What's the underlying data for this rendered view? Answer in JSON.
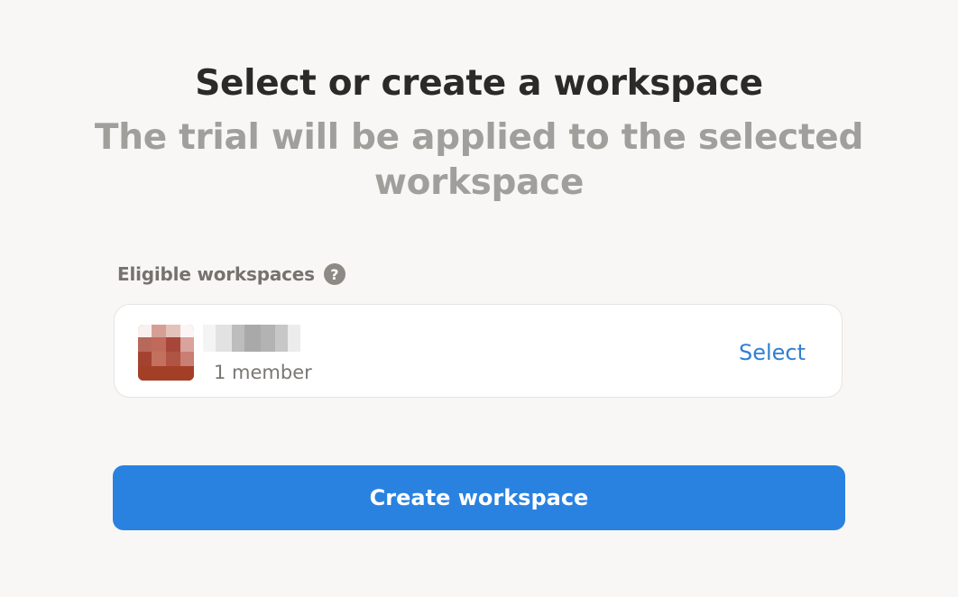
{
  "header": {
    "title": "Select or create a workspace",
    "subtitle": "The trial will be applied to the selected workspace"
  },
  "eligible": {
    "label": "Eligible workspaces",
    "help_icon": "question-circle-icon",
    "help_glyph": "?"
  },
  "workspaces": [
    {
      "icon": "workspace-avatar-icon",
      "name_redacted": true,
      "members": "1 member",
      "select_label": "Select"
    }
  ],
  "actions": {
    "create_label": "Create workspace"
  },
  "colors": {
    "background": "#f8f7f5",
    "accent": "#2a82e0",
    "link": "#2f7fd4",
    "avatar": "#a8422b"
  }
}
